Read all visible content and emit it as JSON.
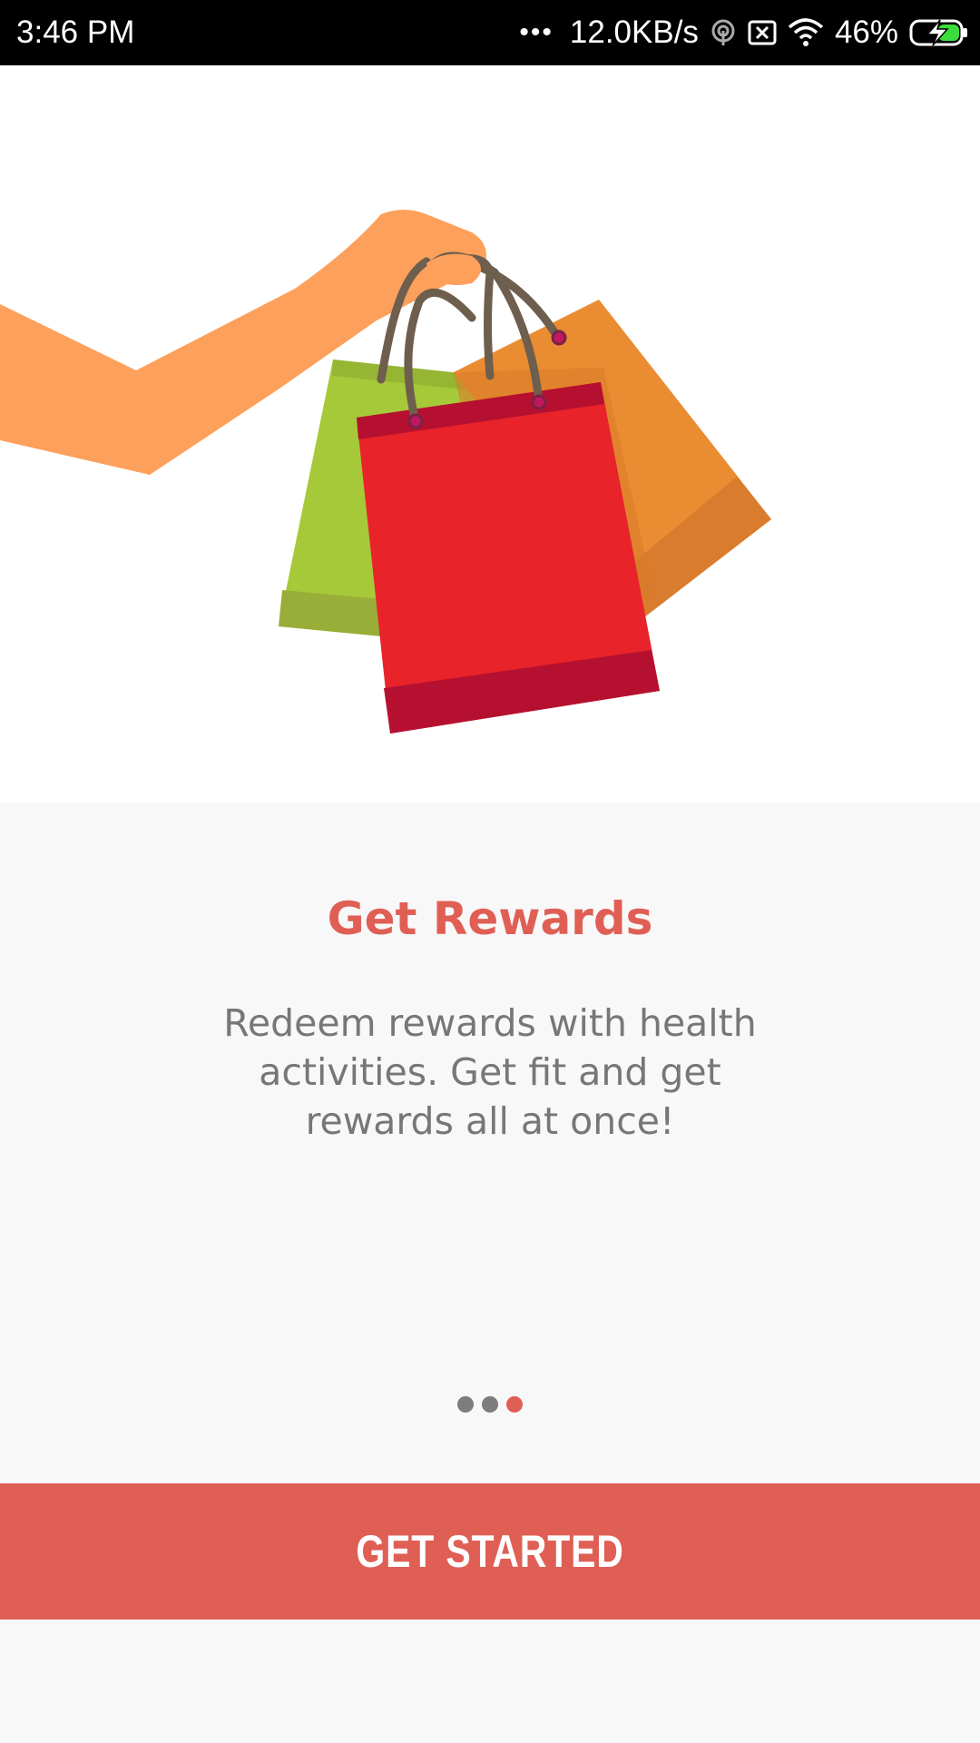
{
  "status_bar": {
    "time": "3:46 PM",
    "more": "•••",
    "network_speed": "12.0KB/s",
    "battery": "46%",
    "icons": [
      "hotspot-icon",
      "no-sim-icon",
      "wifi-icon",
      "battery-charging-icon"
    ]
  },
  "hero": {
    "illustration": "hand-holding-shopping-bags"
  },
  "onboarding": {
    "title": "Get Rewards",
    "description": "Redeem rewards with health activities. Get fit and get rewards all at once!",
    "pages": 3,
    "current_page": 3
  },
  "cta": {
    "label": "GET STARTED"
  },
  "colors": {
    "accent": "#e05f55",
    "dot_inactive": "#7d7d7d",
    "dot_active": "#e05f55",
    "skin": "#fda05c",
    "bag_red": "#e8232a",
    "bag_red_dark": "#b51030",
    "bag_green": "#a6c93a",
    "bag_orange": "#ea8c32",
    "handle": "#6e5e4e"
  }
}
